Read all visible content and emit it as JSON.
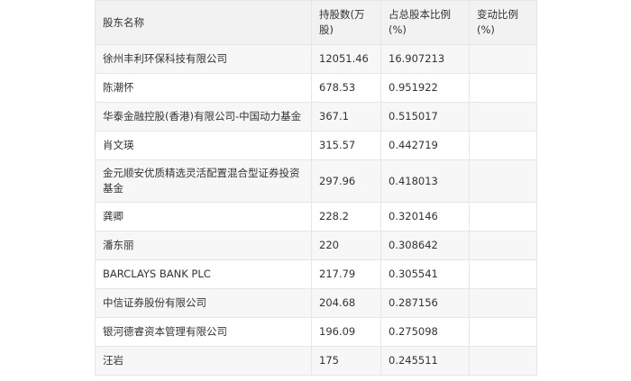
{
  "table": {
    "headers": [
      "股东名称",
      "持股数(万股)",
      "占总股本比例(%)",
      "变动比例(%)"
    ],
    "rows": [
      [
        "徐州丰利环保科技有限公司",
        "12051.46",
        "16.907213",
        ""
      ],
      [
        "陈潮怀",
        "678.53",
        "0.951922",
        ""
      ],
      [
        "华泰金融控股(香港)有限公司-中国动力基金",
        "367.1",
        "0.515017",
        ""
      ],
      [
        "肖文瑛",
        "315.57",
        "0.442719",
        ""
      ],
      [
        "金元顺安优质精选灵活配置混合型证券投资基金",
        "297.96",
        "0.418013",
        ""
      ],
      [
        "龚卿",
        "228.2",
        "0.320146",
        ""
      ],
      [
        "潘东丽",
        "220",
        "0.308642",
        ""
      ],
      [
        "BARCLAYS BANK PLC",
        "217.79",
        "0.305541",
        ""
      ],
      [
        "中信证券股份有限公司",
        "204.68",
        "0.287156",
        ""
      ],
      [
        "银河德睿资本管理有限公司",
        "196.09",
        "0.275098",
        ""
      ],
      [
        "汪岩",
        "175",
        "0.245511",
        ""
      ]
    ]
  }
}
